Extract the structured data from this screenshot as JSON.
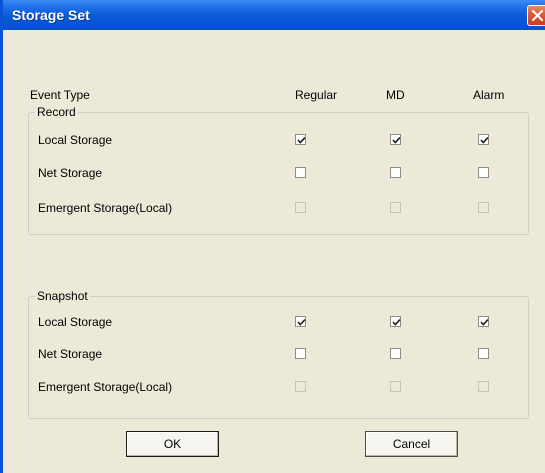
{
  "window": {
    "title": "Storage Set",
    "title_bar_color": "#0a5ad8",
    "close_icon": "close-icon"
  },
  "headers": {
    "event_type": "Event Type",
    "regular": "Regular",
    "md": "MD",
    "alarm": "Alarm"
  },
  "record": {
    "title": "Record",
    "rows": [
      {
        "label": "Local Storage",
        "regular": true,
        "md": true,
        "alarm": true,
        "enabled": true
      },
      {
        "label": "Net Storage",
        "regular": false,
        "md": false,
        "alarm": false,
        "enabled": true
      },
      {
        "label": "Emergent Storage(Local)",
        "regular": false,
        "md": false,
        "alarm": false,
        "enabled": false
      }
    ]
  },
  "snapshot": {
    "title": "Snapshot",
    "rows": [
      {
        "label": "Local Storage",
        "regular": true,
        "md": true,
        "alarm": true,
        "enabled": true
      },
      {
        "label": "Net Storage",
        "regular": false,
        "md": false,
        "alarm": false,
        "enabled": true
      },
      {
        "label": "Emergent Storage(Local)",
        "regular": false,
        "md": false,
        "alarm": false,
        "enabled": false
      }
    ]
  },
  "buttons": {
    "ok": "OK",
    "cancel": "Cancel"
  }
}
